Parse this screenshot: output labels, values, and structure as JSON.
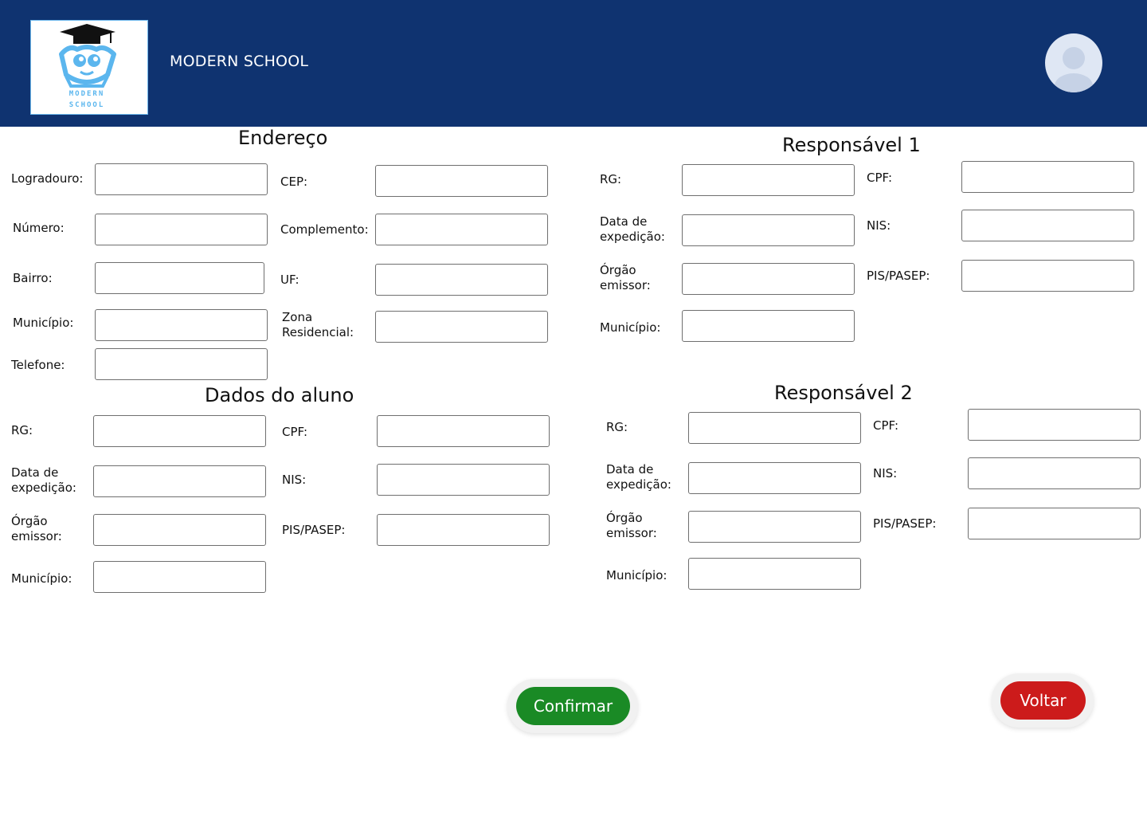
{
  "header": {
    "school_name": "MODERN SCHOOL",
    "logo_line1": "MODERN",
    "logo_line2": "SCHOOL",
    "colors": {
      "background": "#0f3370",
      "logo_blue": "#5bb6ee"
    }
  },
  "endereco": {
    "title": "Endereço",
    "logradouro": "Logradouro:",
    "cep": "CEP:",
    "numero": "Número:",
    "complemento": "Complemento:",
    "bairro": "Bairro:",
    "uf": "UF:",
    "municipio": "Município:",
    "zona": "Zona Residencial:",
    "telefone": "Telefone:"
  },
  "aluno": {
    "title": "Dados do aluno",
    "rg": "RG:",
    "cpf": "CPF:",
    "data_exp": "Data de expedição:",
    "nis": "NIS:",
    "orgao": "Órgão emissor:",
    "pis": "PIS/PASEP:",
    "municipio": "Município:"
  },
  "resp1": {
    "title": "Responsável 1",
    "rg": "RG:",
    "cpf": "CPF:",
    "data_exp": "Data de expedição:",
    "nis": "NIS:",
    "orgao": "Órgão emissor:",
    "pis": "PIS/PASEP:",
    "municipio": "Município:"
  },
  "resp2": {
    "title": "Responsável 2",
    "rg": "RG:",
    "cpf": "CPF:",
    "data_exp": "Data de expedição:",
    "nis": "NIS:",
    "orgao": "Órgão emissor:",
    "pis": "PIS/PASEP:",
    "municipio": "Município:"
  },
  "actions": {
    "confirm_label": "Confirmar",
    "back_label": "Voltar",
    "confirm_color": "#1a8a25",
    "back_color": "#cc1b1b"
  }
}
